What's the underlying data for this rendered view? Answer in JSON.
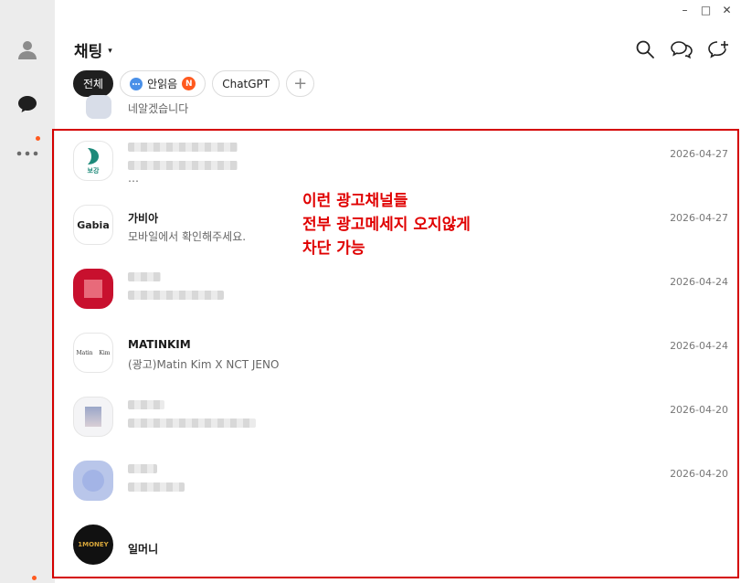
{
  "window": {
    "minimize": "–",
    "maximize": "□",
    "close": "✕"
  },
  "header": {
    "title": "채팅",
    "caret": "▾"
  },
  "chips": [
    {
      "label": "전체",
      "active": true
    },
    {
      "label": "안읽음",
      "badge": "N"
    },
    {
      "label": "ChatGPT"
    },
    {
      "label": "+"
    }
  ],
  "partial_row": {
    "preview": "네알겠습니다"
  },
  "chats": [
    {
      "name": "",
      "preview": "…",
      "date": "2026-04-27",
      "avatar_text": "보강",
      "blurred": true
    },
    {
      "name": "가비아",
      "preview": "모바일에서 확인해주세요.",
      "date": "2026-04-27",
      "avatar_text": "Gabia"
    },
    {
      "name": "",
      "preview": "",
      "date": "2026-04-24",
      "blurred": true
    },
    {
      "name": "MATINKIM",
      "preview": "(광고)Matin Kim X NCT JENO",
      "date": "2026-04-24",
      "avatar_text": "Matin Kim"
    },
    {
      "name": "",
      "preview": "",
      "date": "2026-04-20",
      "blurred": true
    },
    {
      "name": "",
      "preview": "",
      "date": "2026-04-20",
      "blurred": true
    },
    {
      "name": "일머니",
      "preview": "",
      "date": "",
      "avatar_text": "1MONEY"
    }
  ],
  "annotation": {
    "line1": "이런 광고채널들",
    "line2": "전부 광고메세지 오지않게",
    "line3": "차단 가능"
  },
  "colors": {
    "accent": "#ff5a1f",
    "annotation": "#e00000",
    "rail": "#ececec"
  }
}
